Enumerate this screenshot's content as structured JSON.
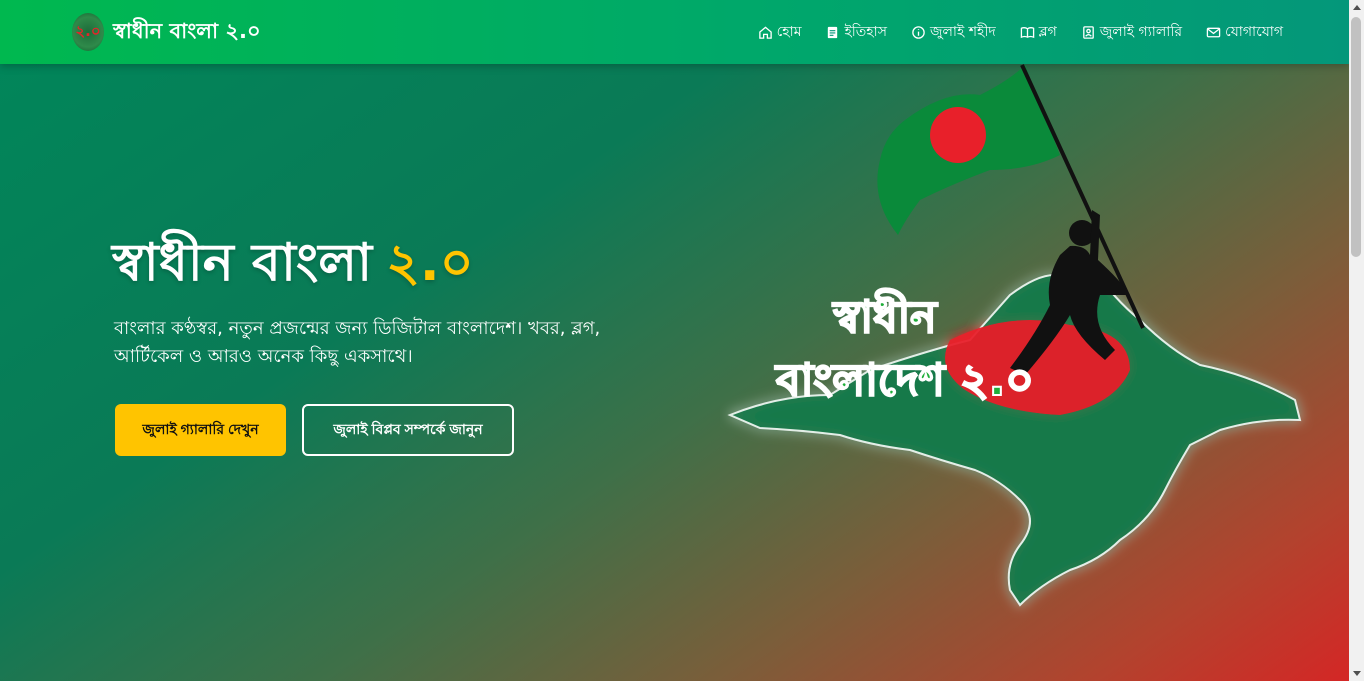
{
  "brand": {
    "logo_text": "২.০",
    "title": "স্বাধীন বাংলা ২.০"
  },
  "nav": {
    "items": [
      {
        "label": "হোম",
        "icon": "home-icon"
      },
      {
        "label": "ইতিহাস",
        "icon": "document-icon"
      },
      {
        "label": "জুলাই শহীদ",
        "icon": "info-icon"
      },
      {
        "label": "ব্লগ",
        "icon": "book-icon"
      },
      {
        "label": "জুলাই গ্যালারি",
        "icon": "gallery-icon"
      },
      {
        "label": "যোগাযোগ",
        "icon": "mail-icon"
      }
    ]
  },
  "hero": {
    "title_main": "স্বাধীন বাংলা",
    "title_accent": "২.০",
    "description": "বাংলার কণ্ঠস্বর, নতুন প্রজন্মের জন্য ডিজিটাল বাংলাদেশ। খবর, ব্লগ, আর্টিকেল ও আরও অনেক কিছু একসাথে।",
    "primary_button": "জুলাই গ্যালারি দেখুন",
    "secondary_button": "জুলাই বিপ্লব সম্পর্কে জানুন",
    "image_text_line1": "স্বাধীন",
    "image_text_line2": "বাংলাদেশ ২.০"
  },
  "colors": {
    "accent": "#ffc400",
    "nav_green": "#00b84f",
    "flag_red": "#e8202a",
    "flag_green": "#0a8a3a"
  }
}
